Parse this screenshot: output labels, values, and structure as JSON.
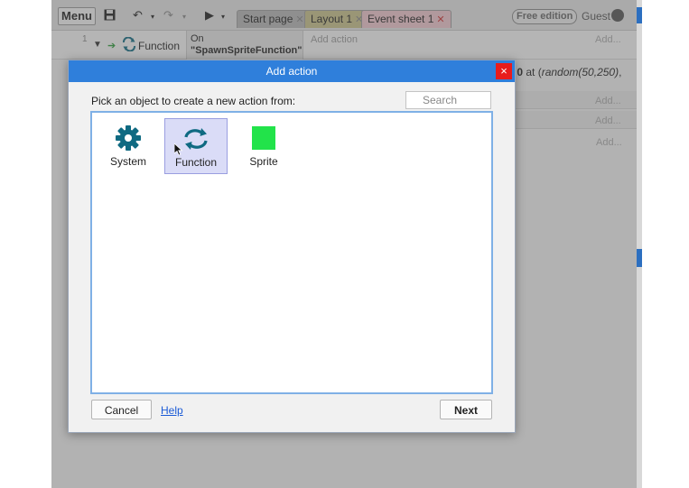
{
  "toolbar": {
    "menu_label": "Menu",
    "tabs": [
      {
        "label": "Start page",
        "color": "#b6b6b6"
      },
      {
        "label": "Layout 1",
        "color": "#c9c28a"
      },
      {
        "label": "Event sheet 1",
        "color": "#f0c6cd"
      }
    ],
    "edition_badge": "Free edition",
    "user_label": "Guest"
  },
  "event_sheet": {
    "row_number": "1",
    "object_label": "Function",
    "condition_line1": "On",
    "condition_line2": "\"SpawnSpriteFunction\"",
    "add_action_label": "Add action",
    "add_label": "Add...",
    "obscured_action_parts": [
      "r ",
      "0",
      " at (",
      "random(50,250)",
      ","
    ]
  },
  "dialog": {
    "title": "Add action",
    "close_glyph": "×",
    "prompt": "Pick an object to create a new action from:",
    "search_placeholder": "Search",
    "objects": [
      {
        "label": "System",
        "icon": "gear-icon",
        "color": "#0f6a82",
        "selected": false
      },
      {
        "label": "Function",
        "icon": "function-icon",
        "color": "#0f6a82",
        "selected": true
      },
      {
        "label": "Sprite",
        "icon": "sprite-icon",
        "color": "#22e34a",
        "selected": false
      }
    ],
    "cancel_label": "Cancel",
    "help_label": "Help",
    "next_label": "Next"
  },
  "colors": {
    "title_bar": "#2f7fdb",
    "close_button": "#e81c1c",
    "selection": "#dadcf7",
    "link": "#1a5ad6"
  }
}
